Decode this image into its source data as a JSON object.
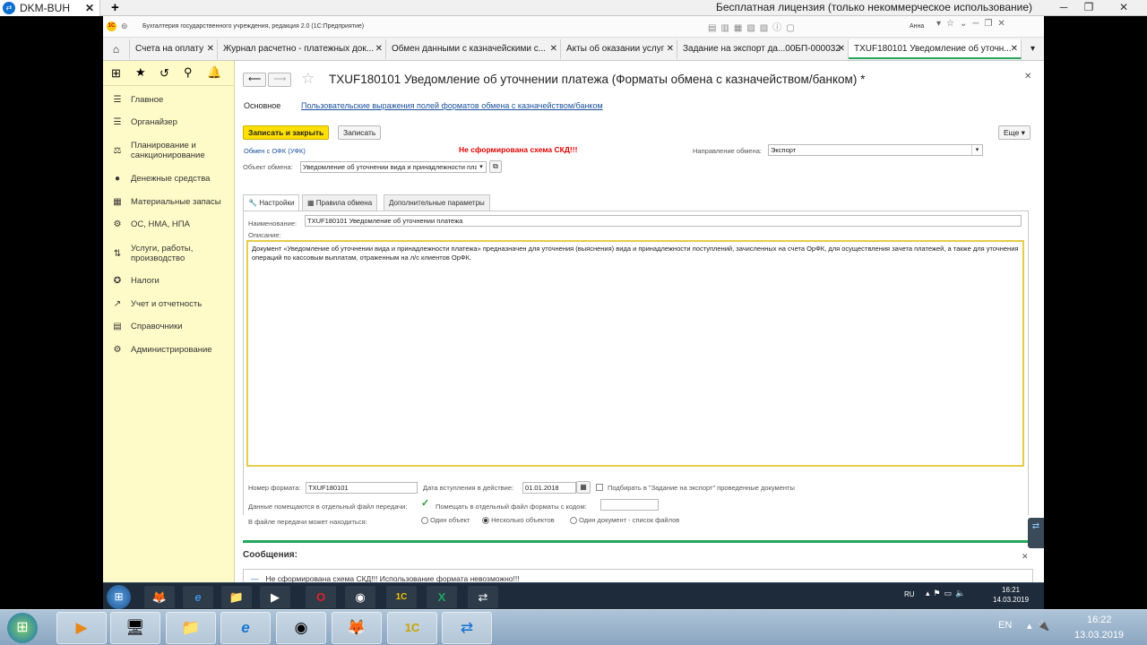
{
  "teamviewer": {
    "tab_label": "DKM-BUH",
    "close": "✕",
    "add": "+",
    "license_text": "Бесплатная лицензия (только некоммерческое использование)"
  },
  "app": {
    "title": "Бухгалтерия государственного учреждения, редакция 2.0 (1С:Предприятие)",
    "user": "Анна"
  },
  "tabs": [
    {
      "label": "Счета на оплату"
    },
    {
      "label": "Журнал расчетно - платежных док..."
    },
    {
      "label": "Обмен данными с казначейскими с..."
    },
    {
      "label": "Акты об оказании услуг"
    },
    {
      "label": "Задание на экспорт да...00БП-000032"
    },
    {
      "label": "TXUF180101 Уведомление об уточн..."
    }
  ],
  "sidebar": {
    "items": [
      {
        "label": "Главное",
        "icon": "menu-icon"
      },
      {
        "label": "Органайзер",
        "icon": "organizer-icon"
      },
      {
        "label": "Планирование и санкционирование",
        "icon": "planning-icon"
      },
      {
        "label": "Денежные средства",
        "icon": "money-icon"
      },
      {
        "label": "Материальные запасы",
        "icon": "materials-icon"
      },
      {
        "label": "ОС, НМА, НПА",
        "icon": "assets-icon"
      },
      {
        "label": "Услуги, работы, производство",
        "icon": "services-icon"
      },
      {
        "label": "Налоги",
        "icon": "taxes-icon"
      },
      {
        "label": "Учет и отчетность",
        "icon": "accounting-icon"
      },
      {
        "label": "Справочники",
        "icon": "reference-icon"
      },
      {
        "label": "Администрирование",
        "icon": "gear-icon"
      }
    ]
  },
  "form": {
    "title": "TXUF180101 Уведомление об уточнении платежа (Форматы обмена с казначейством/банком) *",
    "nav_main": "Основное",
    "nav_link": "Пользовательские выражения полей форматов обмена с казначейством/банком",
    "save_close": "Записать и закрыть",
    "save": "Записать",
    "more": "Еще",
    "exchange_link": "Обмен с ОФК (УФК)",
    "error": "Не сформирована схема СКД!!!",
    "direction_label": "Направление обмена:",
    "direction_value": "Экспорт",
    "object_label": "Объект обмена:",
    "object_value": "Уведомление об уточнении вида и принадлежности пла",
    "tabs": [
      "Настройки",
      "Правила обмена",
      "Дополнительные параметры"
    ],
    "name_label": "Наименование:",
    "name_value": "TXUF180101 Уведомление об уточнении платежа",
    "desc_label": "Описание:",
    "description": "Документ «Уведомление об уточнении вида и принадлежности платежа» предназначен для уточнения (выяснения) вида и принадлежности поступлений, зачисленных на счета ОрФК, для осуществления зачета платежей, а также для уточнения операций по кассовым выплатам, отраженным на л/с клиентов ОрФК.",
    "format_label": "Номер формата:",
    "format_value": "TXUF180101",
    "date_label": "Дата вступления в действие:",
    "date_value": "01.01.2018",
    "pick_label": "Подбирать в \"Задание на экспорт\" проведенные документы",
    "separate_label": "Данные помещаются в отдельный файл передачи:",
    "separate_check": "Помещать в отдельный файл форматы с кодом:",
    "file_label": "В файле передачи может находиться:",
    "radios": [
      "Один объект",
      "Несколько объектов",
      "Один документ - список файлов"
    ],
    "messages_title": "Сообщения:",
    "message": "Не сформирована схема СКД!!! Использование формата невозможно!!!"
  },
  "remote_taskbar": {
    "lang": "RU",
    "time": "16:21",
    "date": "14.03.2019"
  },
  "local_taskbar": {
    "lang": "EN",
    "time": "16:22",
    "date": "13.03.2019"
  },
  "colors": {
    "accent_yellow": "#fff200",
    "sidebar_bg": "#fffbc8",
    "tab_active": "#26a65b",
    "error": "#e00000",
    "link": "#1a4f9c"
  }
}
